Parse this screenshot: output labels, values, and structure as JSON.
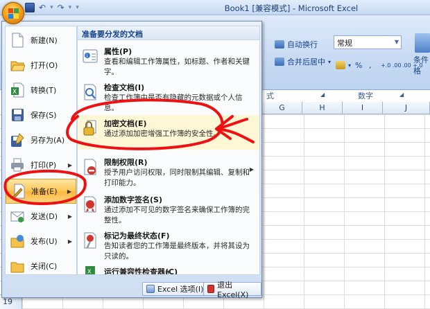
{
  "window": {
    "title": "Book1 [兼容模式] - Microsoft Excel"
  },
  "quick_access": {
    "separator": "▾"
  },
  "ribbon": {
    "wrap_text": "自动换行",
    "merge_center": "合并后居中",
    "number_format": "常规",
    "percent": "%",
    "comma": ",",
    "inc_decimal": "+.0 .00",
    "dec_decimal": ".00 +.0",
    "conditional_format": "条件格",
    "group_alignment_tail": "式",
    "group_number": "数字"
  },
  "grid": {
    "columns": [
      "G",
      "H",
      "I",
      "J"
    ],
    "row_number": "19"
  },
  "menu": {
    "left_items": [
      {
        "label": "新建(N)",
        "icon": "new-document-icon"
      },
      {
        "label": "打开(O)",
        "icon": "open-folder-icon"
      },
      {
        "label": "转换(T)",
        "icon": "convert-icon"
      },
      {
        "label": "保存(S)",
        "icon": "save-disk-icon"
      },
      {
        "label": "另存为(A)",
        "icon": "save-as-icon"
      },
      {
        "label": "打印(P)",
        "icon": "printer-icon"
      },
      {
        "label": "准备(E)",
        "icon": "prepare-icon"
      },
      {
        "label": "发送(D)",
        "icon": "send-icon"
      },
      {
        "label": "发布(U)",
        "icon": "publish-icon"
      },
      {
        "label": "关闭(C)",
        "icon": "close-folder-icon"
      }
    ],
    "right_title": "准备要分发的文档",
    "right_items": [
      {
        "title": "属性(P)",
        "desc": "查看和编辑工作簿属性，如标题、作者和关键字。",
        "icon": "properties-icon"
      },
      {
        "title": "检查文档(I)",
        "desc": "检查工作簿中是否有隐藏的元数据或个人信息。",
        "icon": "inspect-document-icon"
      },
      {
        "title": "加密文档(E)",
        "desc": "通过添加加密增强工作簿的安全性。",
        "icon": "encrypt-lock-icon"
      },
      {
        "title": "限制权限(R)",
        "desc": "授予用户访问权限，同时限制其编辑、复制和打印能力。",
        "icon": "restrict-permission-icon"
      },
      {
        "title": "添加数字签名(S)",
        "desc": "通过添加不可见的数字签名来确保工作簿的完整性。",
        "icon": "digital-signature-icon"
      },
      {
        "title": "标记为最终状态(F)",
        "desc": "告知读者您的工作簿是最终版本，并将其设为只读的。",
        "icon": "mark-final-icon"
      },
      {
        "title": "运行兼容性检查器(C)",
        "desc": "",
        "icon": "compatibility-checker-icon"
      }
    ],
    "excel_options": "Excel 选项(I)",
    "exit_excel": "退出 Excel(X)"
  }
}
